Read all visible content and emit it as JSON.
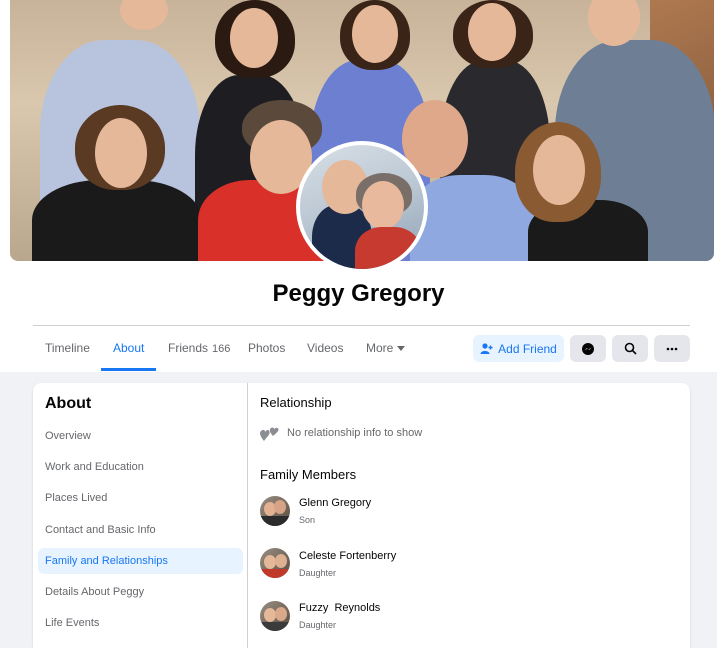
{
  "profile": {
    "name": "Peggy Gregory"
  },
  "tabs": {
    "timeline": "Timeline",
    "about": "About",
    "friends": "Friends",
    "friends_count": "166",
    "photos": "Photos",
    "videos": "Videos",
    "more": "More"
  },
  "actions": {
    "add_friend": "Add Friend"
  },
  "sidebar": {
    "title": "About",
    "items": [
      {
        "label": "Overview"
      },
      {
        "label": "Work and Education"
      },
      {
        "label": "Places Lived"
      },
      {
        "label": "Contact and Basic Info"
      },
      {
        "label": "Family and Relationships"
      },
      {
        "label": "Details About Peggy"
      },
      {
        "label": "Life Events"
      }
    ]
  },
  "main": {
    "relationship_title": "Relationship",
    "relationship_text": "No relationship info to show",
    "family_title": "Family Members",
    "family": [
      {
        "name": "Glenn Gregory",
        "relation": "Son"
      },
      {
        "name": "Celeste Fortenberry",
        "relation": "Daughter"
      },
      {
        "name": "Fuzzy  Reynolds",
        "relation": "Daughter"
      }
    ]
  },
  "colors": {
    "accent": "#1877f2",
    "page_bg": "#f0f2f5",
    "button_bg": "#e4e6eb",
    "highlight_bg": "#e7f3ff"
  }
}
